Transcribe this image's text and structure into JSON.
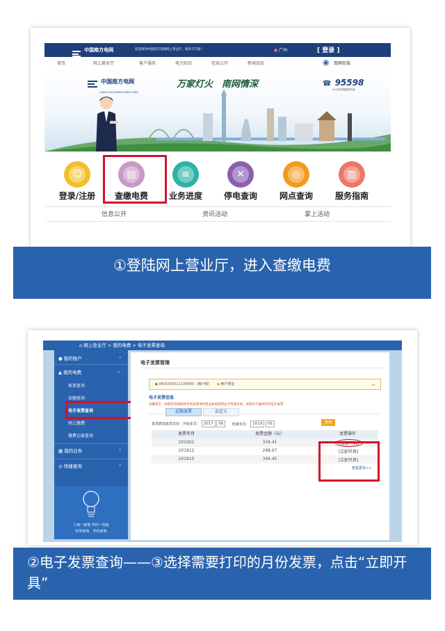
{
  "panel1": {
    "header": {
      "logo_text": "中国南方电网",
      "slogan": "欢迎来到中国南方电网网上营业厅，服务千万家！",
      "region": "广州",
      "login_label": "[ 登录 ]",
      "app_label": "南网在线"
    },
    "nav": [
      "首页",
      "网上营业厅",
      "客户服务",
      "电力知识",
      "信息公开",
      "新闻动态"
    ],
    "banner": {
      "logo_text": "中国南方电网",
      "logo_sub": "CHINA SOUTHERN POWER GRID",
      "slogan": "万家灯火　南网情深",
      "hotline": "95598",
      "hotline_sub": "24小时供电服务热线"
    },
    "services": [
      {
        "label": "登录/注册",
        "icon": "login-icon",
        "color": "#f3c02a"
      },
      {
        "label": "查缴电费",
        "icon": "bill-icon",
        "color": "#c79ac6"
      },
      {
        "label": "业务进度",
        "icon": "progress-icon",
        "color": "#2db3a6"
      },
      {
        "label": "停电查询",
        "icon": "outage-icon",
        "color": "#8a5fb0"
      },
      {
        "label": "网点查询",
        "icon": "location-icon",
        "color": "#f39a1e"
      },
      {
        "label": "服务指南",
        "icon": "guide-icon",
        "color": "#ee7666"
      }
    ],
    "sub_links": [
      "信息公开",
      "资讯活动",
      "掌上活动"
    ]
  },
  "caption1": "①登陆网上营业厅，进入查缴电费",
  "panel2": {
    "breadcrumb": "网上营业厅 > 我的电费 > 电子发票查询",
    "sidebar": {
      "account": "我的账户",
      "bill": "我的电费",
      "bill_items": [
        "账单查询",
        "余额查询",
        "电子发票查询",
        "网上缴费",
        "缴费记录查询"
      ],
      "business": "我的业务",
      "query": "快捷查询",
      "promo_line1": "少用一度电 节约一份能",
      "promo_line2": "科学用电　节约用电"
    },
    "main": {
      "title": "电子发票管理",
      "account_text": "0401000111100000（西户街）",
      "account_sub": "用户地址",
      "section_title": "电子发票信息",
      "notice": "温馨提示：如需开具增值税专用发票请持营业执照到营业厅申请开具，请及时下载并打印电子发票",
      "tabs": [
        "近期发票",
        "自定义"
      ],
      "filter": {
        "label": "查询费用发票月份：开始年月：",
        "start_year": "2017",
        "start_month": "06",
        "end_label": "结束年月：",
        "end_year": "2019",
        "end_month": "06",
        "button": "查询"
      },
      "table": {
        "headers": [
          "发票年月",
          "发票金额（元）",
          "发票操作"
        ],
        "rows": [
          {
            "month": "201902",
            "amount": "334.41",
            "action": "[立即开具]"
          },
          {
            "month": "201812",
            "amount": "288.67",
            "action": "[立即开具]"
          },
          {
            "month": "201810",
            "amount": "344.45",
            "action": "[立即开具]"
          }
        ],
        "more": "查看更多>>"
      }
    }
  },
  "caption2": "②电子发票查询——③选择需要打印的月份发票，点击“立即开具”",
  "colors": {
    "accent": "#2a63ad",
    "highlight": "#d3102a",
    "header": "#1d3f7a"
  }
}
